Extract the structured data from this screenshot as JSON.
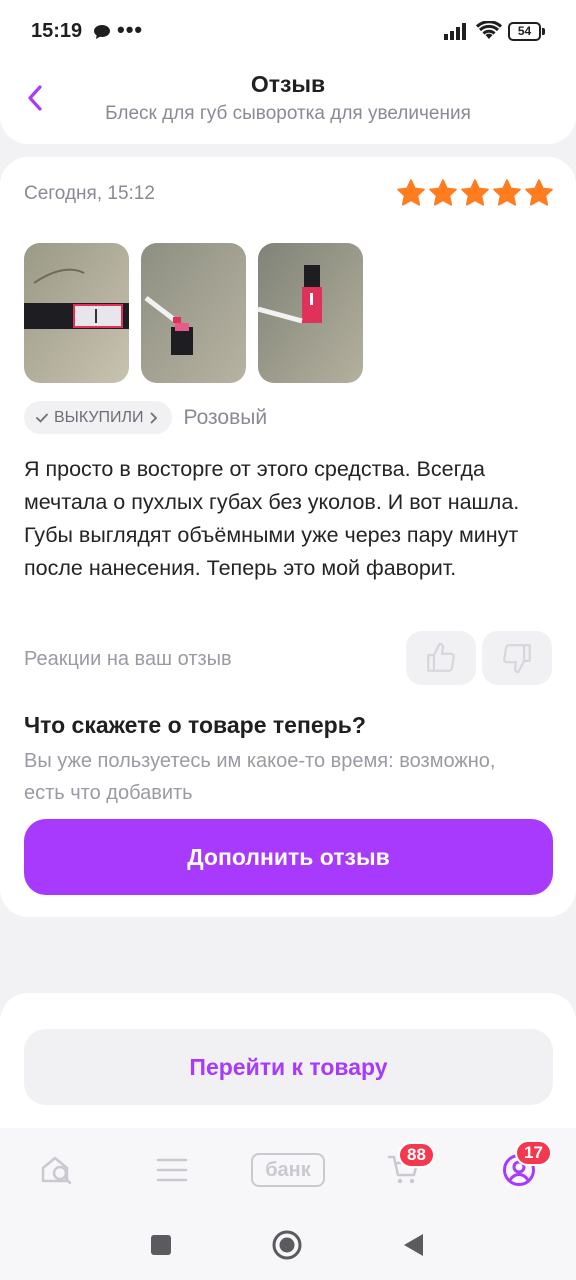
{
  "status_bar": {
    "time": "15:19",
    "dots": "•••",
    "battery": "54"
  },
  "header": {
    "title": "Отзыв",
    "subtitle": "Блеск для губ сыворотка для увеличения"
  },
  "review": {
    "date": "Сегодня, 15:12",
    "rating": 5,
    "photos": [
      "photo-1",
      "photo-2",
      "photo-3"
    ],
    "badge_label": "ВЫКУПИЛИ",
    "variant": "Розовый",
    "text": "Я просто в восторге от этого средства. Всегда мечтала о пухлых губах без уколов. И вот нашла. Губы выглядят объёмными уже через пару минут после нанесения. Теперь это мой фаворит.",
    "reactions_label": "Реакции на ваш отзыв"
  },
  "cta": {
    "title": "Что скажете о товаре теперь?",
    "description": "Вы уже пользуетесь им какое-то время: возможно, есть что добавить",
    "button_label": "Дополнить отзыв"
  },
  "goto_product_label": "Перейти к товару",
  "tabbar": {
    "bank_label": "банк",
    "cart_badge": "88",
    "profile_badge": "17"
  },
  "colors": {
    "accent": "#a73afd",
    "star": "#ff7d1f",
    "badge": "#f5384e"
  }
}
